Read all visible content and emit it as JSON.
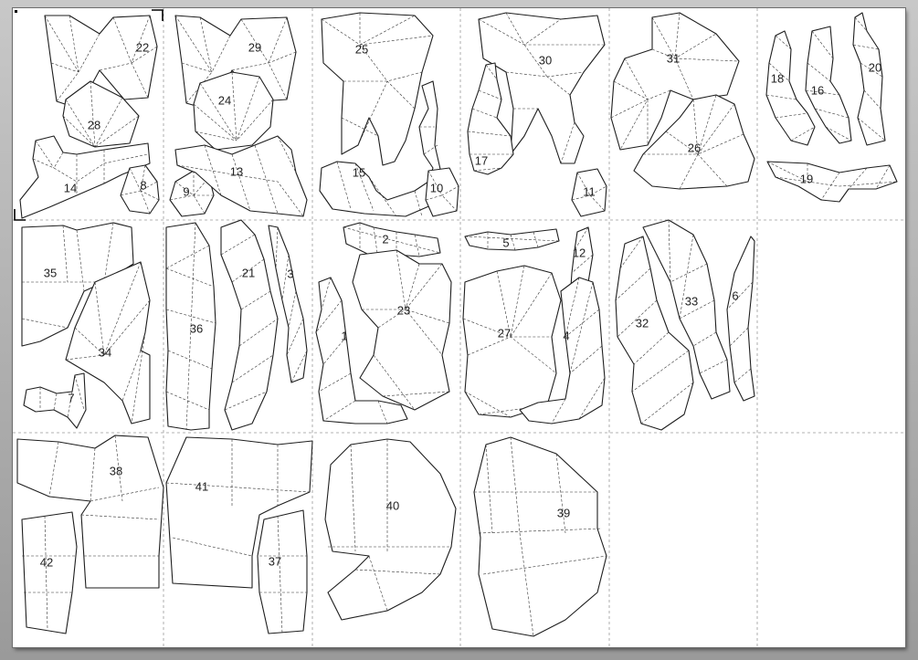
{
  "page": {
    "background": "#a9a9a9",
    "sheet_color": "#ffffff"
  },
  "pieces": [
    {
      "id": "22",
      "label": "22"
    },
    {
      "id": "29",
      "label": "29"
    },
    {
      "id": "25",
      "label": "25"
    },
    {
      "id": "30",
      "label": "30"
    },
    {
      "id": "31",
      "label": "31"
    },
    {
      "id": "18",
      "label": "18"
    },
    {
      "id": "16",
      "label": "16"
    },
    {
      "id": "20",
      "label": "20"
    },
    {
      "id": "28",
      "label": "28"
    },
    {
      "id": "24",
      "label": "24"
    },
    {
      "id": "26",
      "label": "26"
    },
    {
      "id": "17",
      "label": "17"
    },
    {
      "id": "14",
      "label": "14"
    },
    {
      "id": "8",
      "label": "8"
    },
    {
      "id": "9",
      "label": "9"
    },
    {
      "id": "13",
      "label": "13"
    },
    {
      "id": "15",
      "label": "15"
    },
    {
      "id": "10",
      "label": "10"
    },
    {
      "id": "11",
      "label": "11"
    },
    {
      "id": "19",
      "label": "19"
    },
    {
      "id": "35",
      "label": "35"
    },
    {
      "id": "21",
      "label": "21"
    },
    {
      "id": "3",
      "label": "3"
    },
    {
      "id": "2",
      "label": "2"
    },
    {
      "id": "5",
      "label": "5"
    },
    {
      "id": "12",
      "label": "12"
    },
    {
      "id": "23",
      "label": "23"
    },
    {
      "id": "6",
      "label": "6"
    },
    {
      "id": "33",
      "label": "33"
    },
    {
      "id": "36",
      "label": "36"
    },
    {
      "id": "1",
      "label": "1"
    },
    {
      "id": "27",
      "label": "27"
    },
    {
      "id": "4",
      "label": "4"
    },
    {
      "id": "32",
      "label": "32"
    },
    {
      "id": "34",
      "label": "34"
    },
    {
      "id": "7",
      "label": "7"
    },
    {
      "id": "38",
      "label": "38"
    },
    {
      "id": "41",
      "label": "41"
    },
    {
      "id": "40",
      "label": "40"
    },
    {
      "id": "39",
      "label": "39"
    },
    {
      "id": "42",
      "label": "42"
    },
    {
      "id": "37",
      "label": "37"
    }
  ]
}
